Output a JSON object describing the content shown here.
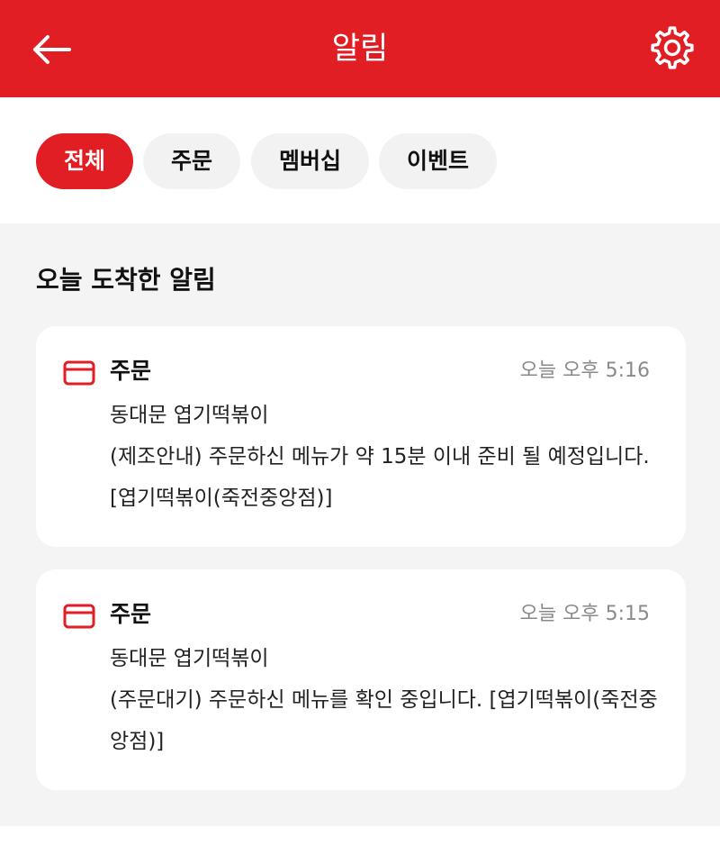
{
  "header": {
    "title": "알림",
    "back_icon": "back-arrow-icon",
    "settings_icon": "gear-icon",
    "bg_color": "#e01e24"
  },
  "tabs": [
    {
      "label": "전체",
      "active": true
    },
    {
      "label": "주문",
      "active": false
    },
    {
      "label": "멤버십",
      "active": false
    },
    {
      "label": "이벤트",
      "active": false
    }
  ],
  "section": {
    "title": "오늘 도착한 알림"
  },
  "notifications": [
    {
      "category": "주문",
      "icon": "card-icon",
      "time": "오늘 오후 5:16",
      "store": "동대문 엽기떡볶이",
      "message": "(제조안내) 주문하신 메뉴가 약 15분 이내 준비 될 예정입니다. [엽기떡볶이(죽전중앙점)]"
    },
    {
      "category": "주문",
      "icon": "card-icon",
      "time": "오늘 오후 5:15",
      "store": "동대문 엽기떡볶이",
      "message": "(주문대기) 주문하신 메뉴를 확인 중입니다. [엽기떡볶이(죽전중앙점)]"
    }
  ]
}
